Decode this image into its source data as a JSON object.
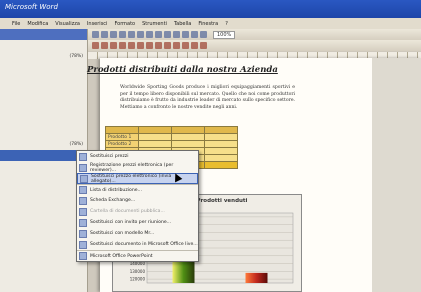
{
  "window": {
    "title": "Microsoft Word"
  },
  "menu": [
    "File",
    "Modifica",
    "Visualizza",
    "Inserisci",
    "Formato",
    "Strumenti",
    "Tabella",
    "Finestra",
    "?"
  ],
  "toolbar": {
    "zoom": "100%"
  },
  "taskpane": {
    "rows": [
      "",
      "(78%)",
      "",
      "",
      "",
      "",
      "",
      "",
      "",
      "(78%)",
      "",
      "",
      "",
      "",
      "",
      ""
    ],
    "selected": ""
  },
  "document": {
    "heading": "Prodotti distribuiti dalla nostra Azienda",
    "paragraph": "Worldwide Sporting Goods produce i migliori equipaggiamenti sportivi e per il tempo libero disponibili sul mercato. Quello che noi come produttori distribuiamo è frutto da industrie leader di mercato sullo specifico settore. Mettiamo a confronto le nostre vendite negli anni."
  },
  "table": {
    "headers": [
      "",
      "",
      "",
      ""
    ],
    "rows": [
      [
        "Prodotto 1",
        "",
        "",
        ""
      ],
      [
        "Prodotto 2",
        "",
        "",
        ""
      ],
      [
        "",
        "",
        "",
        ""
      ],
      [
        "",
        "",
        "",
        ""
      ],
      [
        "",
        "",
        "",
        ""
      ]
    ]
  },
  "context_menu": {
    "items": [
      {
        "label": "Sostituisci prezzi",
        "state": "normal"
      },
      {
        "label": "Registrazione prezzi elettronica (per reviewer)...",
        "state": "normal"
      },
      {
        "label": "Sostituisci prezzo elettronico (invia allegato)...",
        "state": "highlight"
      },
      {
        "label": "Lista di distribuzione...",
        "state": "normal"
      },
      {
        "label": "Scheda Exchange...",
        "state": "normal"
      },
      {
        "label": "Cartella di documenti pubblica...",
        "state": "dim"
      },
      {
        "label": "Sostituisci con invito per riunione...",
        "state": "normal"
      },
      {
        "label": "Sostituisci con modello Mr...",
        "state": "normal"
      },
      {
        "label": "Sostituisci documento in Microsoft Office live...",
        "state": "normal"
      },
      {
        "label": "Microsoft Office PowerPoint",
        "state": "normal"
      }
    ]
  },
  "chart": {
    "title": "Prodotti venduti"
  },
  "chart_data": {
    "type": "bar",
    "title": "Prodotti venduti",
    "categories": [
      "",
      ""
    ],
    "values": [
      192000,
      128000
    ],
    "yticks": [
      120000,
      130000,
      140000,
      150000,
      160000,
      170000,
      180000,
      190000,
      200000
    ],
    "ylim": [
      115000,
      205000
    ],
    "colors": [
      "#4f8f14",
      "#c0281e"
    ]
  }
}
